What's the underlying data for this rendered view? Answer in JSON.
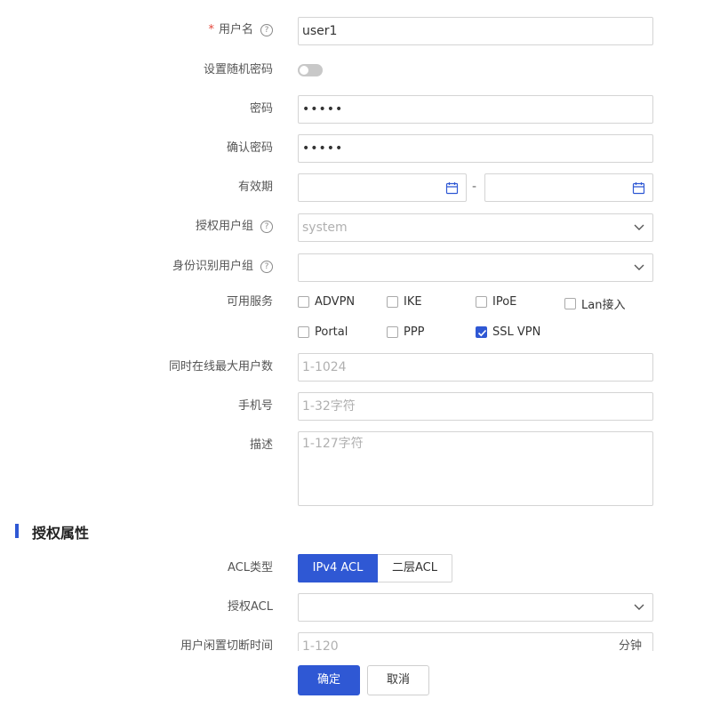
{
  "form": {
    "username": {
      "label": "用户名",
      "required_mark": "*",
      "value": "user1"
    },
    "random_password": {
      "label": "设置随机密码",
      "enabled": false
    },
    "password": {
      "label": "密码",
      "value": "•••••"
    },
    "confirm_password": {
      "label": "确认密码",
      "value": "•••••"
    },
    "validity": {
      "label": "有效期",
      "separator": "-"
    },
    "auth_group": {
      "label": "授权用户组",
      "value": "system"
    },
    "identity_group": {
      "label": "身份识别用户组",
      "value": ""
    },
    "services": {
      "label": "可用服务",
      "items": [
        {
          "name": "ADVPN",
          "checked": false
        },
        {
          "name": "IKE",
          "checked": false
        },
        {
          "name": "IPoE",
          "checked": false
        },
        {
          "name": "Lan接入",
          "checked": false
        },
        {
          "name": "Portal",
          "checked": false
        },
        {
          "name": "PPP",
          "checked": false
        },
        {
          "name": "SSL VPN",
          "checked": true
        }
      ]
    },
    "max_online": {
      "label": "同时在线最大用户数",
      "placeholder": "1-1024"
    },
    "phone": {
      "label": "手机号",
      "placeholder": "1-32字符"
    },
    "description": {
      "label": "描述",
      "placeholder": "1-127字符"
    }
  },
  "auth_section": {
    "title": "授权属性",
    "acl_type": {
      "label": "ACL类型",
      "options": [
        "IPv4 ACL",
        "二层ACL"
      ],
      "selected": "IPv4 ACL"
    },
    "auth_acl": {
      "label": "授权ACL",
      "value": ""
    },
    "idle_timeout": {
      "label": "用户闲置切断时间",
      "placeholder": "1-120",
      "unit": "分钟"
    }
  },
  "actions": {
    "ok": "确定",
    "cancel": "取消"
  },
  "colors": {
    "primary": "#2f58d4",
    "required": "#e3463a"
  }
}
